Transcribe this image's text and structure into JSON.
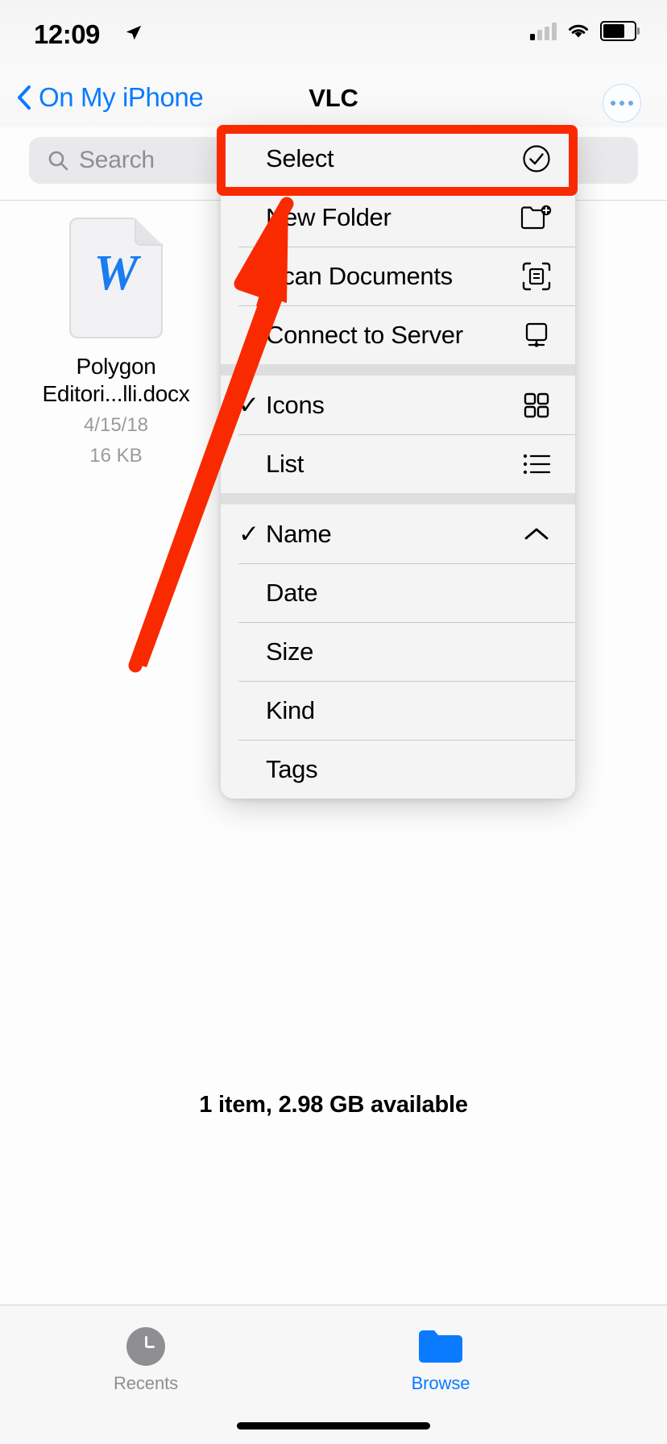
{
  "status_bar": {
    "time": "12:09",
    "location_icon": "location-arrow-icon",
    "cellular_icon": "cellular-signal-icon",
    "cellular_bars_filled": 1,
    "cellular_bars_total": 4,
    "wifi_icon": "wifi-icon",
    "battery_icon": "battery-icon"
  },
  "nav_bar": {
    "back_label": "On My iPhone",
    "back_icon": "chevron-left-icon",
    "title": "VLC",
    "more_icon": "ellipsis-circle-icon"
  },
  "search": {
    "placeholder": "Search",
    "value": "",
    "icon": "search-icon"
  },
  "files": [
    {
      "name": "Polygon\nEditori...lli.docx",
      "name_line1": "Polygon",
      "name_line2": "Editori...lli.docx",
      "date": "4/15/18",
      "size": "16 KB",
      "icon": "word-document-icon",
      "icon_glyph": "W",
      "icon_color": "#1a7cf0"
    }
  ],
  "context_menu": {
    "groups": [
      {
        "items": [
          {
            "label": "Select",
            "icon": "checkmark-circle-icon",
            "checked": false,
            "highlighted": true
          },
          {
            "label": "New Folder",
            "icon": "folder-badge-plus-icon",
            "checked": false,
            "highlighted": false
          },
          {
            "label": "Scan Documents",
            "icon": "document-scanner-icon",
            "checked": false,
            "highlighted": false
          },
          {
            "label": "Connect to Server",
            "icon": "display-icon",
            "checked": false,
            "highlighted": false
          }
        ]
      },
      {
        "items": [
          {
            "label": "Icons",
            "icon": "grid-2x2-icon",
            "checked": true,
            "highlighted": false
          },
          {
            "label": "List",
            "icon": "list-bullet-icon",
            "checked": false,
            "highlighted": false
          }
        ]
      },
      {
        "items": [
          {
            "label": "Name",
            "icon": "chevron-up-icon",
            "checked": true,
            "highlighted": false
          },
          {
            "label": "Date",
            "icon": "",
            "checked": false,
            "highlighted": false
          },
          {
            "label": "Size",
            "icon": "",
            "checked": false,
            "highlighted": false
          },
          {
            "label": "Kind",
            "icon": "",
            "checked": false,
            "highlighted": false
          },
          {
            "label": "Tags",
            "icon": "",
            "checked": false,
            "highlighted": false
          }
        ]
      }
    ],
    "checkmark_glyph": "✓"
  },
  "annotation": {
    "highlight_color": "#fa2a00",
    "highlight_target": "Select",
    "arrow_icon": "pointer-arrow-annotation"
  },
  "footer": {
    "status_text": "1 item, 2.98 GB available"
  },
  "tab_bar": {
    "tabs": [
      {
        "label": "Recents",
        "icon": "clock-icon",
        "active": false
      },
      {
        "label": "Browse",
        "icon": "folder-icon",
        "active": true
      }
    ],
    "active_color": "#0a7bff",
    "inactive_color": "#8e8e93"
  }
}
